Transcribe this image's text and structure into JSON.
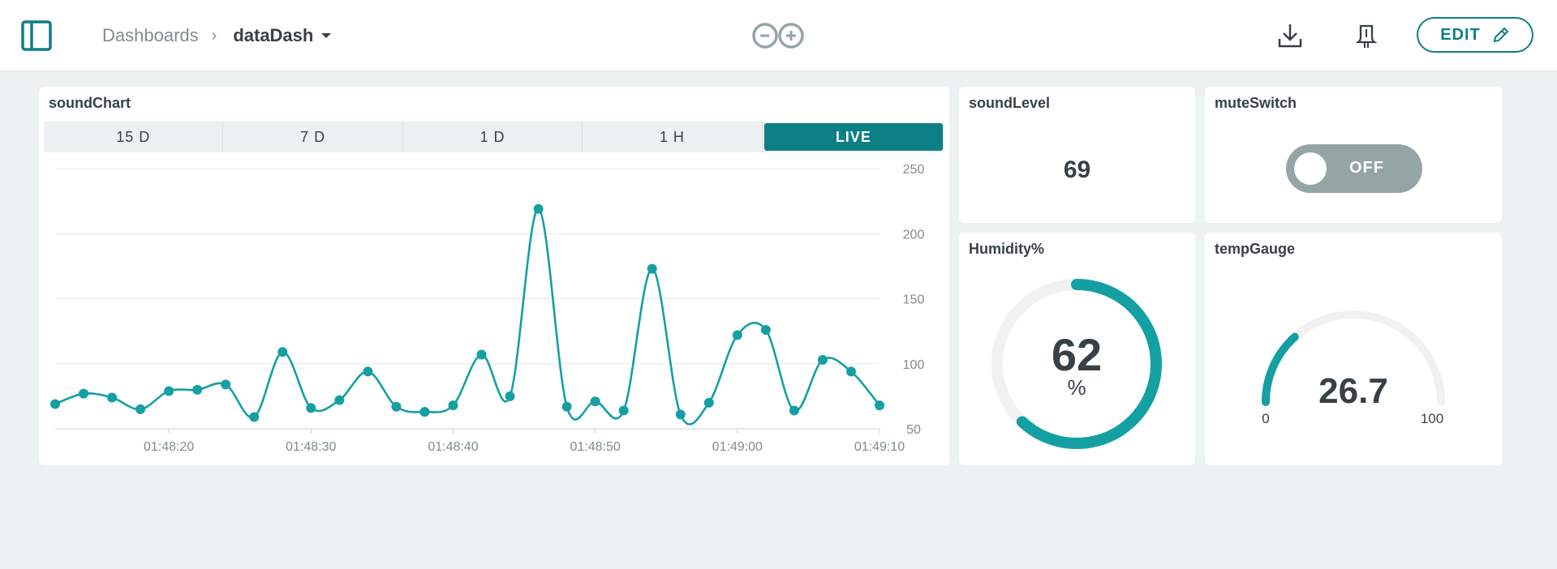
{
  "header": {
    "breadcrumb_root": "Dashboards",
    "breadcrumb_sep": "›",
    "dashboard_name": "dataDash",
    "edit_label": "EDIT"
  },
  "colors": {
    "accent": "#0c7f84",
    "series": "#14a0a3",
    "gauge_track": "#f0f2f2",
    "toggle_off": "#95a5a6"
  },
  "icons": [
    "sidebar-toggle-icon",
    "arduino-logo",
    "download-icon",
    "bell-icon",
    "pencil-icon"
  ],
  "widgets": {
    "sound_chart": {
      "title": "soundChart",
      "ranges": [
        "15 D",
        "7 D",
        "1 D",
        "1 H",
        "LIVE"
      ],
      "active_range": "LIVE"
    },
    "sound_level": {
      "title": "soundLevel",
      "value": "69"
    },
    "mute_switch": {
      "title": "muteSwitch",
      "state": "OFF"
    },
    "humidity": {
      "title": "Humidity%",
      "value": "62",
      "unit": "%",
      "fraction": 0.62
    },
    "temp_gauge": {
      "title": "tempGauge",
      "value": "26.7",
      "min": "0",
      "max": "100",
      "fraction": 0.267
    }
  },
  "chart_data": {
    "type": "line",
    "title": "soundChart",
    "xlabel": "",
    "ylabel": "",
    "ylim": [
      50,
      250
    ],
    "yticks": [
      "50",
      "100",
      "150",
      "200",
      "250"
    ],
    "xticks": [
      "01:48:20",
      "01:48:30",
      "01:48:40",
      "01:48:50",
      "01:49:00",
      "01:49:10"
    ],
    "xlim": [
      "01:48:12",
      "01:49:10"
    ],
    "grid": true,
    "series": [
      {
        "x": [
          "01:48:12",
          "01:48:14",
          "01:48:16",
          "01:48:18",
          "01:48:20",
          "01:48:22",
          "01:48:24",
          "01:48:26",
          "01:48:28",
          "01:48:30",
          "01:48:32",
          "01:48:34",
          "01:48:36",
          "01:48:38",
          "01:48:40",
          "01:48:42",
          "01:48:44",
          "01:48:46",
          "01:48:48",
          "01:48:50",
          "01:48:52",
          "01:48:54",
          "01:48:56",
          "01:48:58",
          "01:49:00",
          "01:49:02",
          "01:49:04",
          "01:49:06",
          "01:49:08",
          "01:49:10"
        ],
        "y": [
          69,
          77,
          74,
          65,
          79,
          80,
          84,
          59,
          109,
          66,
          72,
          94,
          67,
          63,
          68,
          107,
          75,
          219,
          67,
          71,
          64,
          173,
          61,
          70,
          122,
          126,
          64,
          103,
          94,
          68
        ]
      }
    ]
  }
}
